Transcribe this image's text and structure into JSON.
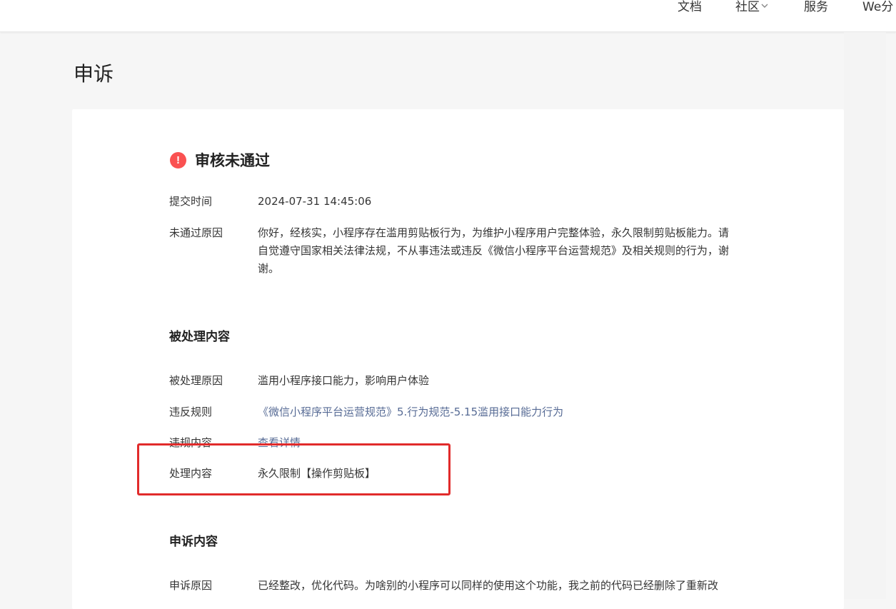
{
  "nav": {
    "items": [
      {
        "label": "文档"
      },
      {
        "label": "社区"
      },
      {
        "label": "服务"
      },
      {
        "label": "We分"
      }
    ]
  },
  "page": {
    "title": "申诉"
  },
  "status": {
    "icon": "exclamation-icon",
    "icon_glyph": "!",
    "title": "审核未通过",
    "color": "#fa5151"
  },
  "submission": {
    "time_label": "提交时间",
    "time_value": "2024-07-31 14:45:06",
    "reason_label": "未通过原因",
    "reason_value": "你好，经核实，小程序存在滥用剪贴板行为，为维护小程序用户完整体验，永久限制剪贴板能力。请自觉遵守国家相关法律法规，不从事违法或违反《微信小程序平台运营规范》及相关规则的行为，谢谢。"
  },
  "processed": {
    "section_title": "被处理内容",
    "reason_label": "被处理原因",
    "reason_value": "滥用小程序接口能力，影响用户体验",
    "rule_label": "违反规则",
    "rule_value": "《微信小程序平台运营规范》5.行为规范-5.15滥用接口能力行为",
    "content_label": "违规内容",
    "content_value": "查看详情",
    "action_label": "处理内容",
    "action_value": "永久限制【操作剪贴板】"
  },
  "appeal": {
    "section_title": "申诉内容",
    "reason_label": "申诉原因",
    "reason_value": "已经整改，优化代码。为啥别的小程序可以同样的使用这个功能，我之前的代码已经删除了重新改"
  },
  "colors": {
    "link": "#576b95",
    "highlight": "#e12b2b"
  }
}
